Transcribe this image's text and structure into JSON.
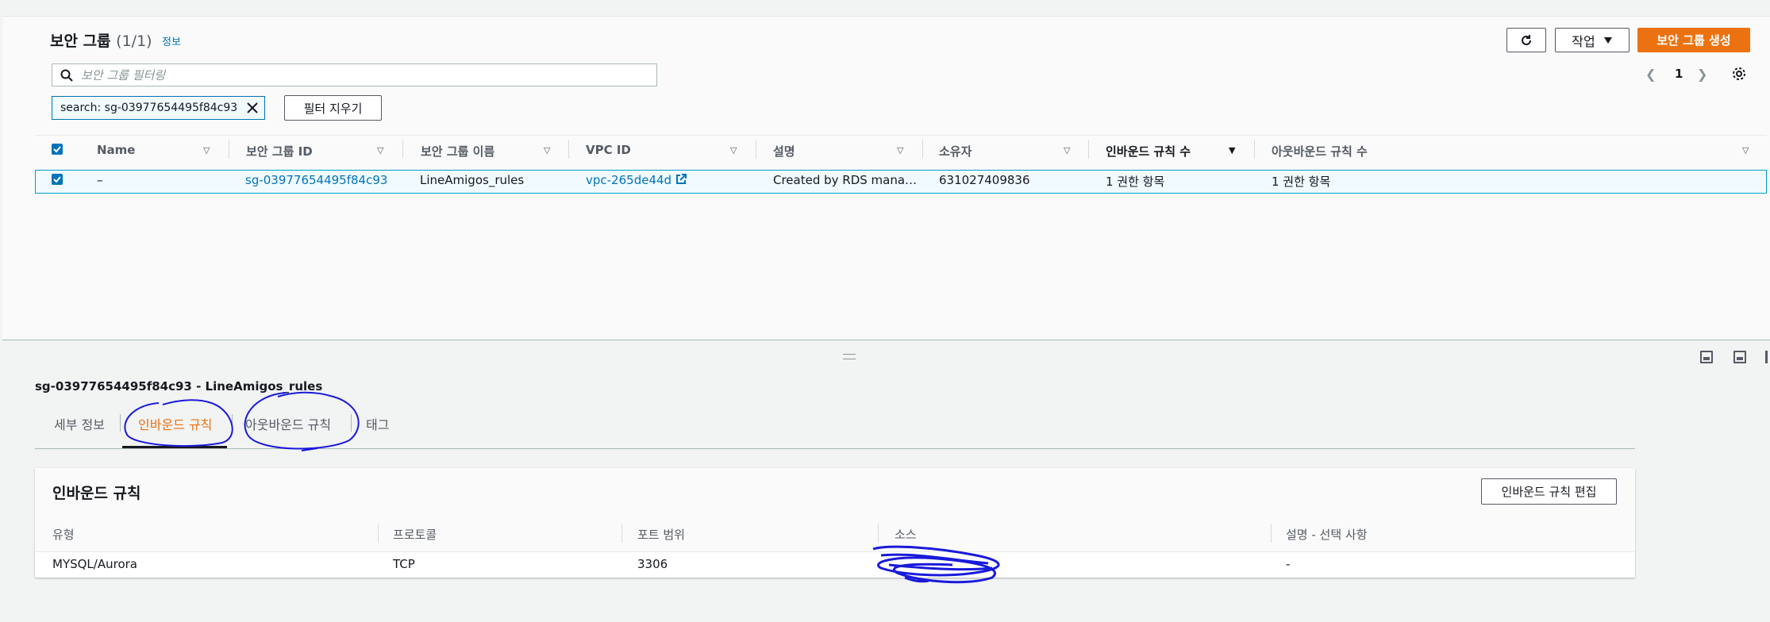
{
  "security_groups": {
    "title": "보안 그룹",
    "count": "(1/1)",
    "info_link": "정보",
    "refresh_icon": "refresh-icon",
    "actions_label": "작업",
    "create_label": "보안 그룹 생성",
    "search_placeholder": "보안 그룹 필터링",
    "page_number": "1",
    "filter_token": "search: sg-03977654495f84c93",
    "clear_filters_label": "필터 지우기",
    "columns": [
      "Name",
      "보안 그룹 ID",
      "보안 그룹 이름",
      "VPC ID",
      "설명",
      "소유자",
      "인바운드 규칙 수",
      "아웃바운드 규칙 수"
    ],
    "row": {
      "name": "–",
      "group_id": "sg-03977654495f84c93",
      "group_name": "LineAmigos_rules",
      "vpc_id": "vpc-265de44d",
      "description": "Created by RDS mana…",
      "owner": "631027409836",
      "inbound_count": "1 권한 항목",
      "outbound_count": "1 권한 항목"
    }
  },
  "detail": {
    "title": "sg-03977654495f84c93 - LineAmigos_rules",
    "tabs": [
      "세부 정보",
      "인바운드 규칙",
      "아웃바운드 규칙",
      "태그"
    ],
    "active_tab": "인바운드 규칙",
    "inbound": {
      "title": "인바운드 규칙",
      "edit_label": "인바운드 규칙 편집",
      "columns": [
        "유형",
        "프로토콜",
        "포트 범위",
        "소스",
        "설명 - 선택 사항"
      ],
      "row": {
        "type": "MYSQL/Aurora",
        "protocol": "TCP",
        "port_range": "3306",
        "source": "",
        "description": "-"
      }
    }
  },
  "colors": {
    "accent": "#ec7211",
    "link": "#0073bb",
    "annotation": "#1a1adb"
  }
}
